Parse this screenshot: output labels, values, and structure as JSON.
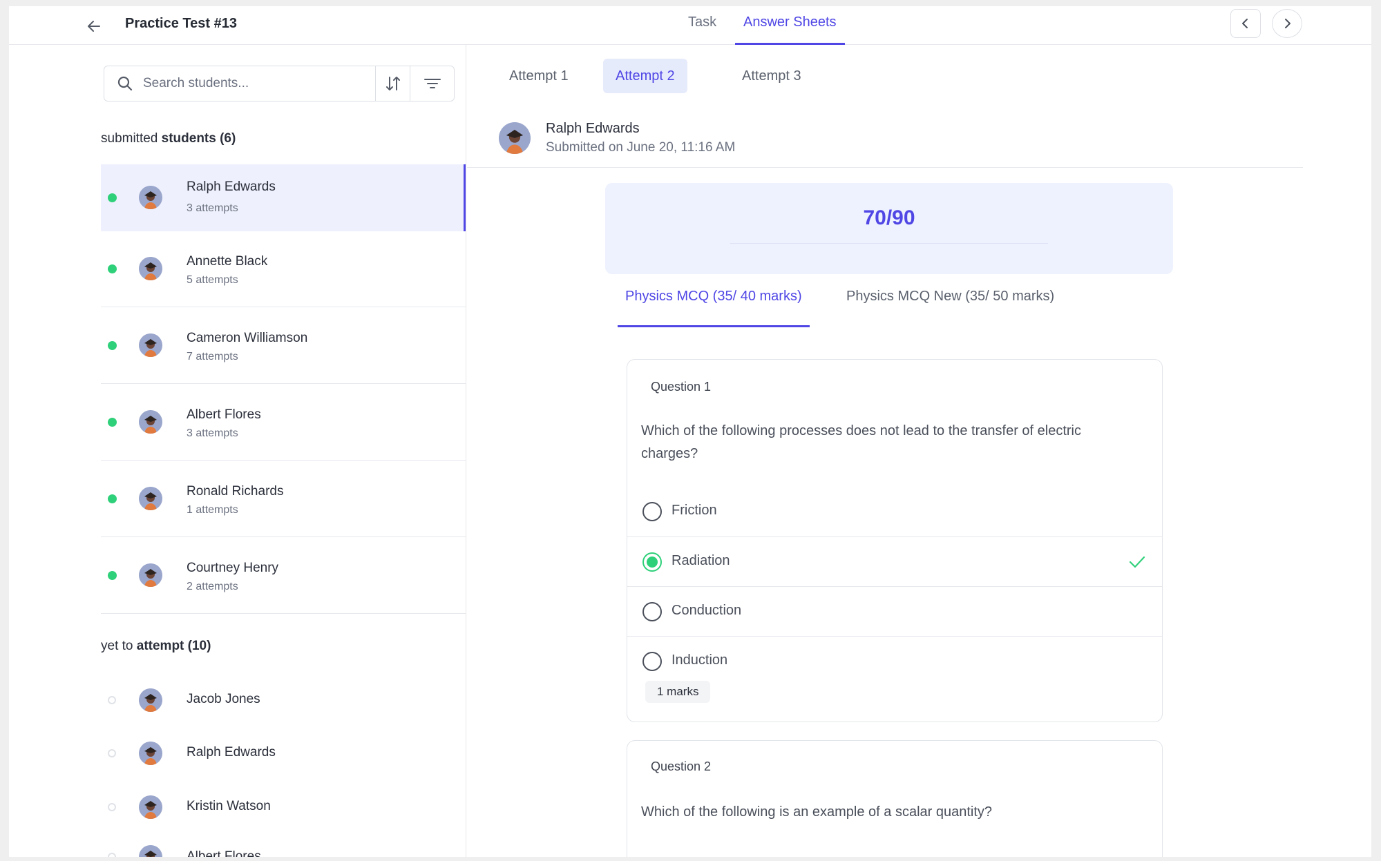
{
  "header": {
    "title": "Practice Test #13",
    "tabs": [
      {
        "label": "Task",
        "active": false
      },
      {
        "label": "Answer Sheets",
        "active": true
      }
    ]
  },
  "sidebar": {
    "search_placeholder": "Search students...",
    "submitted_heading_prefix": "submitted",
    "submitted_heading_bold": "students (6)",
    "submitted": [
      {
        "name": "Ralph Edwards",
        "attempts": "3 attempts",
        "selected": true
      },
      {
        "name": "Annette Black",
        "attempts": "5 attempts"
      },
      {
        "name": "Cameron Williamson",
        "attempts": "7 attempts"
      },
      {
        "name": "Albert Flores",
        "attempts": "3 attempts"
      },
      {
        "name": "Ronald Richards",
        "attempts": "1 attempts"
      },
      {
        "name": "Courtney Henry",
        "attempts": "2 attempts"
      }
    ],
    "pending_heading_prefix": "yet to",
    "pending_heading_bold": "attempt (10)",
    "pending": [
      {
        "name": "Jacob Jones"
      },
      {
        "name": "Ralph Edwards"
      },
      {
        "name": "Kristin Watson"
      },
      {
        "name": "Albert Flores"
      }
    ]
  },
  "main": {
    "attempts": [
      {
        "label": "Attempt 1",
        "active": false
      },
      {
        "label": "Attempt 2",
        "active": true
      },
      {
        "label": "Attempt 3",
        "active": false
      }
    ],
    "submission": {
      "name": "Ralph Edwards",
      "submitted": "Submitted on June 20, 11:16 AM"
    },
    "score": "70/90",
    "sections": [
      {
        "label": "Physics MCQ (35/ 40 marks)",
        "active": true
      },
      {
        "label": "Physics MCQ New (35/ 50 marks)",
        "active": false
      }
    ],
    "questions": [
      {
        "label": "Question 1",
        "text": "Which of the following processes does not lead to the transfer of electric charges?",
        "options": [
          {
            "label": "Friction",
            "selected": false
          },
          {
            "label": "Radiation",
            "selected": true,
            "correct": true
          },
          {
            "label": "Conduction",
            "selected": false
          },
          {
            "label": "Induction",
            "selected": false
          }
        ],
        "marks": "1 marks"
      },
      {
        "label": "Question 2",
        "text": "Which of the following is an example of a scalar quantity?"
      }
    ]
  },
  "colors": {
    "accent": "#4f46e5",
    "accent_bg": "#eef1fd",
    "success": "#2fd07a",
    "border": "#e6e8ec"
  }
}
